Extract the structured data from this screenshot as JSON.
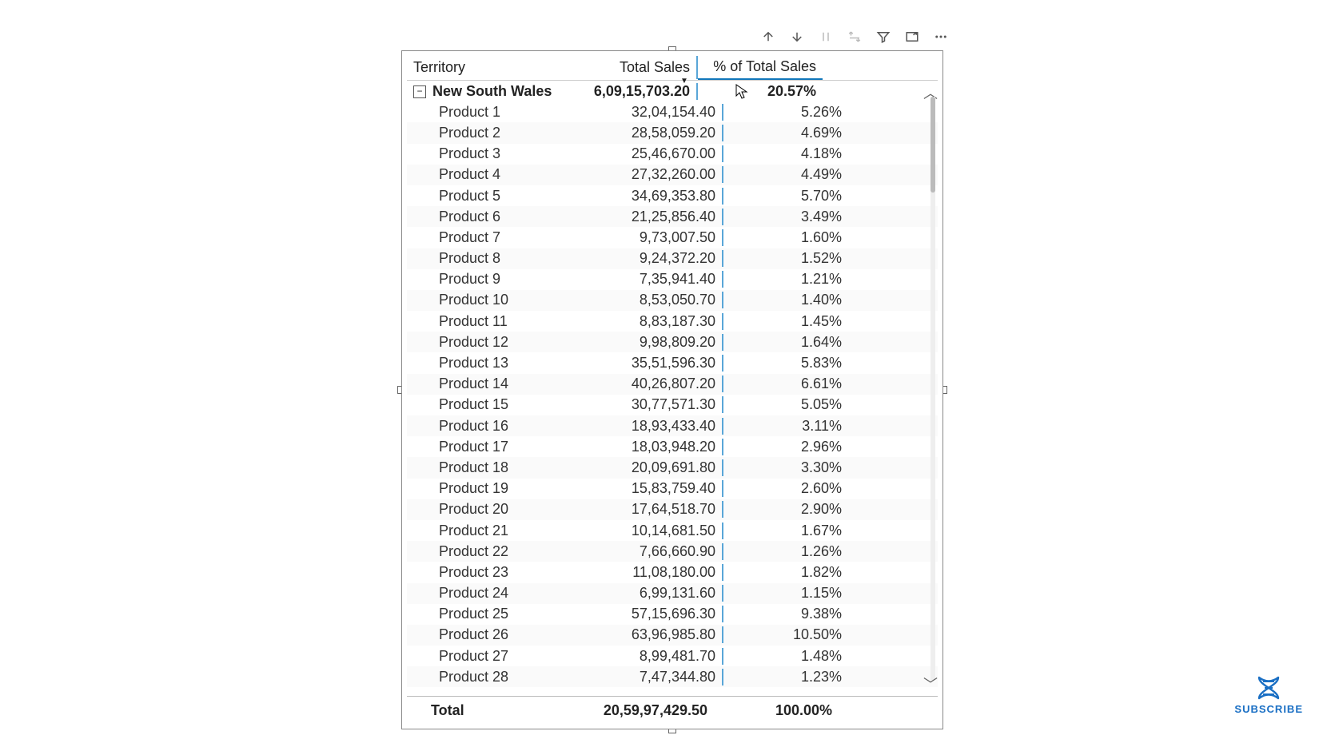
{
  "columns": {
    "territory": "Territory",
    "total_sales": "Total Sales",
    "pct_total_sales": "% of Total Sales"
  },
  "group": {
    "label": "New South Wales",
    "total_sales": "6,09,15,703.20",
    "pct": "20.57%"
  },
  "rows": [
    {
      "label": "Product 1",
      "sales": "32,04,154.40",
      "pct": "5.26%"
    },
    {
      "label": "Product 2",
      "sales": "28,58,059.20",
      "pct": "4.69%"
    },
    {
      "label": "Product 3",
      "sales": "25,46,670.00",
      "pct": "4.18%"
    },
    {
      "label": "Product 4",
      "sales": "27,32,260.00",
      "pct": "4.49%"
    },
    {
      "label": "Product 5",
      "sales": "34,69,353.80",
      "pct": "5.70%"
    },
    {
      "label": "Product 6",
      "sales": "21,25,856.40",
      "pct": "3.49%"
    },
    {
      "label": "Product 7",
      "sales": "9,73,007.50",
      "pct": "1.60%"
    },
    {
      "label": "Product 8",
      "sales": "9,24,372.20",
      "pct": "1.52%"
    },
    {
      "label": "Product 9",
      "sales": "7,35,941.40",
      "pct": "1.21%"
    },
    {
      "label": "Product 10",
      "sales": "8,53,050.70",
      "pct": "1.40%"
    },
    {
      "label": "Product 11",
      "sales": "8,83,187.30",
      "pct": "1.45%"
    },
    {
      "label": "Product 12",
      "sales": "9,98,809.20",
      "pct": "1.64%"
    },
    {
      "label": "Product 13",
      "sales": "35,51,596.30",
      "pct": "5.83%"
    },
    {
      "label": "Product 14",
      "sales": "40,26,807.20",
      "pct": "6.61%"
    },
    {
      "label": "Product 15",
      "sales": "30,77,571.30",
      "pct": "5.05%"
    },
    {
      "label": "Product 16",
      "sales": "18,93,433.40",
      "pct": "3.11%"
    },
    {
      "label": "Product 17",
      "sales": "18,03,948.20",
      "pct": "2.96%"
    },
    {
      "label": "Product 18",
      "sales": "20,09,691.80",
      "pct": "3.30%"
    },
    {
      "label": "Product 19",
      "sales": "15,83,759.40",
      "pct": "2.60%"
    },
    {
      "label": "Product 20",
      "sales": "17,64,518.70",
      "pct": "2.90%"
    },
    {
      "label": "Product 21",
      "sales": "10,14,681.50",
      "pct": "1.67%"
    },
    {
      "label": "Product 22",
      "sales": "7,66,660.90",
      "pct": "1.26%"
    },
    {
      "label": "Product 23",
      "sales": "11,08,180.00",
      "pct": "1.82%"
    },
    {
      "label": "Product 24",
      "sales": "6,99,131.60",
      "pct": "1.15%"
    },
    {
      "label": "Product 25",
      "sales": "57,15,696.30",
      "pct": "9.38%"
    },
    {
      "label": "Product 26",
      "sales": "63,96,985.80",
      "pct": "10.50%"
    },
    {
      "label": "Product 27",
      "sales": "8,99,481.70",
      "pct": "1.48%"
    },
    {
      "label": "Product 28",
      "sales": "7,47,344.80",
      "pct": "1.23%"
    }
  ],
  "totals": {
    "label": "Total",
    "sales": "20,59,97,429.50",
    "pct": "100.00%"
  },
  "subscribe_label": "SUBSCRIBE"
}
